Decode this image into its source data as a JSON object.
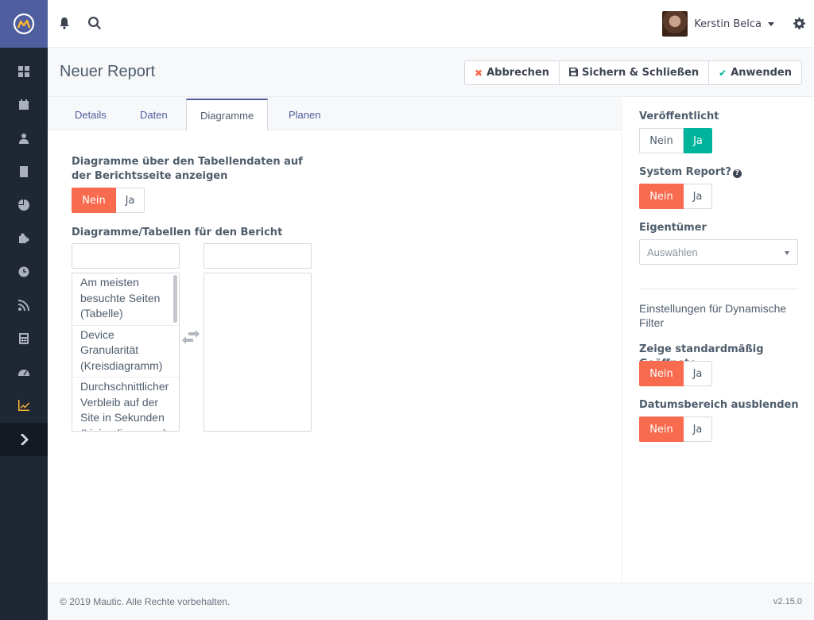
{
  "topbar": {
    "user_name": "Kerstin Belca"
  },
  "page": {
    "title": "Neuer Report",
    "buttons": {
      "cancel": "Abbrechen",
      "save_close": "Sichern & Schließen",
      "apply": "Anwenden"
    }
  },
  "tabs": [
    "Details",
    "Daten",
    "Diagramme",
    "Planen"
  ],
  "active_tab": "Diagramme",
  "main": {
    "show_charts_label": "Diagramme über den Tabellendaten auf der Berichtsseite anzeigen",
    "show_charts_toggle": {
      "no": "Nein",
      "yes": "Ja",
      "selected": "Nein"
    },
    "charts_label": "Diagramme/Tabellen für den Bericht",
    "available_items": [
      "Am meisten besuchte Seiten (Tabelle)",
      "Device Granularität (Kreisdiagramm)",
      "Durchschnittlicher Verbleib auf der Site in Sekunden (Liniendiagramm)"
    ],
    "selected_items": []
  },
  "right": {
    "published_label": "Veröffentlicht",
    "published_toggle": {
      "no": "Nein",
      "yes": "Ja",
      "selected": "Ja"
    },
    "system_report_label": "System Report?",
    "system_report_toggle": {
      "no": "Nein",
      "yes": "Ja",
      "selected": "Nein"
    },
    "owner_label": "Eigentümer",
    "owner_placeholder": "Auswählen",
    "dynamic_filter_heading": "Einstellungen für Dynamische Filter",
    "show_open_label": "Zeige standardmäßig Geöffnete",
    "show_open_toggle": {
      "no": "Nein",
      "yes": "Ja",
      "selected": "Nein"
    },
    "hide_date_label": "Datumsbereich ausblenden",
    "hide_date_toggle": {
      "no": "Nein",
      "yes": "Ja",
      "selected": "Nein"
    }
  },
  "footer": {
    "copyright": "© 2019 Mautic. Alle Rechte vorbehalten.",
    "version": "v2.15.0"
  },
  "colors": {
    "accent": "#4e5e9e",
    "danger": "#f86b4f",
    "success": "#00b49c",
    "sidebar": "#1f2733",
    "active_nav": "#fdb933"
  },
  "sidebar_icons": [
    "dashboard-icon",
    "calendar-icon",
    "contacts-icon",
    "companies-icon",
    "segments-icon",
    "components-icon",
    "campaigns-icon",
    "channels-icon",
    "points-icon",
    "stages-icon",
    "reports-icon"
  ]
}
